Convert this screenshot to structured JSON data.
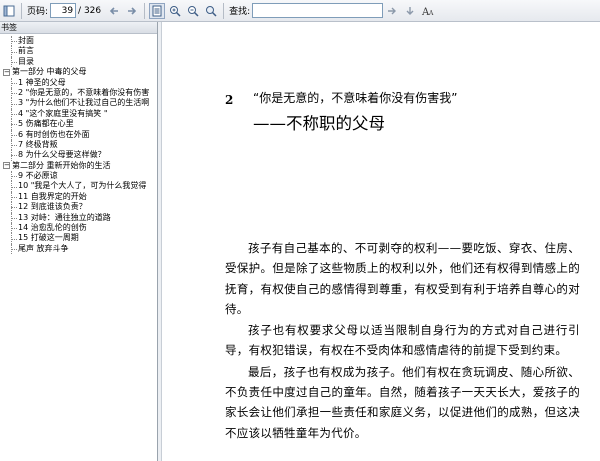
{
  "toolbar": {
    "page_label": "页码:",
    "page_value": "39",
    "page_total": "/ 326",
    "search_label": "查找:",
    "search_value": "",
    "icons": [
      "sidebar-toggle-icon",
      "back-arrow-icon",
      "forward-arrow-icon",
      "page-view-icon",
      "zoom-in-icon",
      "zoom-out-icon",
      "zoom-fit-icon",
      "find-icon",
      "find-next-icon",
      "font-size-icon"
    ]
  },
  "sidebar": {
    "header": "书签",
    "items": [
      {
        "label": "封面",
        "level": 1
      },
      {
        "label": "前言",
        "level": 1
      },
      {
        "label": "目录",
        "level": 1
      },
      {
        "label": "第一部分  中毒的父母",
        "level": 0,
        "expanded": true
      },
      {
        "label": "1 神圣的父母",
        "level": 1
      },
      {
        "label": "2  \"你是无意的，不意味着你没有伤害",
        "level": 1
      },
      {
        "label": "3  \"为什么他们不让我过自己的生活啊",
        "level": 1
      },
      {
        "label": "4  \"这个家庭里没有搞笑 \"",
        "level": 1
      },
      {
        "label": "5 伤痛都在心里",
        "level": 1
      },
      {
        "label": "6 有时创伤也在外面",
        "level": 1
      },
      {
        "label": "7 终极背叛",
        "level": 1
      },
      {
        "label": "8 为什么父母要这样做？",
        "level": 1
      },
      {
        "label": "第二部分  重新开始你的生活",
        "level": 0,
        "expanded": true
      },
      {
        "label": "9 不必原谅",
        "level": 1
      },
      {
        "label": "10  \"我是个大人了，可为什么我觉得",
        "level": 1
      },
      {
        "label": "11 自我界定的开始",
        "level": 1
      },
      {
        "label": "12 到底谁该负责？",
        "level": 1
      },
      {
        "label": "13 对峙：通往独立的道路",
        "level": 1
      },
      {
        "label": "14 治愈乱伦的创伤",
        "level": 1
      },
      {
        "label": "15 打破这一周期",
        "level": 1
      },
      {
        "label": "尾声  放弃斗争",
        "level": 1
      }
    ]
  },
  "document": {
    "chapter_number": "2",
    "chapter_subtitle": "“你是无意的，不意味着你没有伤害我”",
    "chapter_title": "——不称职的父母",
    "paragraphs": [
      "孩子有自己基本的、不可剥夺的权利——要吃饭、穿衣、住房、受保护。但是除了这些物质上的权利以外，他们还有权得到情感上的抚育，有权使自己的感情得到尊重，有权受到有利于培养自尊心的对待。",
      "孩子也有权要求父母以适当限制自身行为的方式对自己进行引导，有权犯错误，有权在不受肉体和感情虐待的前提下受到约束。",
      "最后，孩子也有权成为孩子。他们有权在贪玩调皮、随心所欲、不负责任中度过自己的童年。自然，随着孩子一天天长大，爱孩子的家长会让他们承担一些责任和家庭义务，以促进他们的成熟，但这决不应该以牺牲童年为代价。"
    ]
  }
}
